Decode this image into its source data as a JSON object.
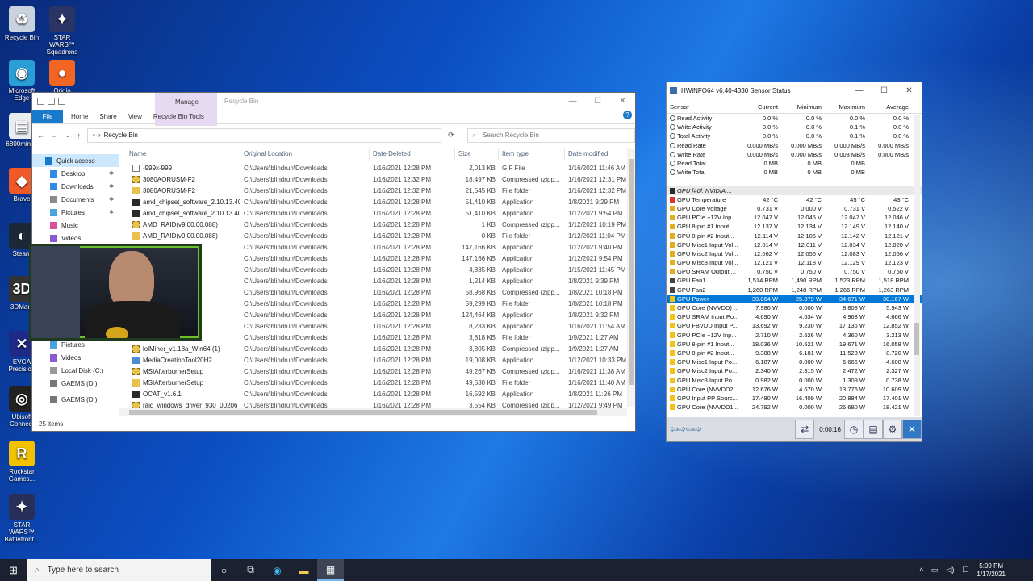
{
  "desktop": {
    "icons": [
      {
        "label": "Recycle Bin"
      },
      {
        "label": "STAR WARS™ Squadrons"
      },
      {
        "label": "Microsoft Edge"
      },
      {
        "label": "Origin"
      },
      {
        "label": "6800mini..."
      },
      {
        "label": "Brave"
      },
      {
        "label": "Steam"
      },
      {
        "label": "3DMark"
      },
      {
        "label": "EVGA Precision"
      },
      {
        "label": "Ubisoft Connect"
      },
      {
        "label": "Rockstar Games..."
      },
      {
        "label": "STAR WARS™ Battlefront..."
      }
    ]
  },
  "explorer": {
    "title": "Recycle Bin",
    "manage_label": "Manage",
    "tabs": [
      "File",
      "Home",
      "Share",
      "View",
      "Recycle Bin Tools"
    ],
    "address": "Recycle Bin",
    "search_placeholder": "Search Recycle Bin",
    "nav": [
      {
        "label": "Quick access"
      },
      {
        "label": "Desktop"
      },
      {
        "label": "Downloads"
      },
      {
        "label": "Documents"
      },
      {
        "label": "Pictures"
      },
      {
        "label": "Music"
      },
      {
        "label": "Videos"
      },
      {
        "label": "Pictures"
      },
      {
        "label": "Videos"
      },
      {
        "label": "Local Disk (C:)"
      },
      {
        "label": "GAEMS (D:)"
      },
      {
        "label": "GAEMS (D:)"
      }
    ],
    "columns": [
      "Name",
      "Original Location",
      "Date Deleted",
      "Size",
      "Item type",
      "Date modified"
    ],
    "rows": [
      {
        "icon": "gif",
        "name": "-999x-999",
        "loc": "C:\\Users\\blindrun\\Downloads",
        "del": "1/16/2021 12:28 PM",
        "size": "2,013 KB",
        "type": "GIF File",
        "mod": "1/16/2021 11:46 AM"
      },
      {
        "icon": "zip",
        "name": "3080AORUSM-F2",
        "loc": "C:\\Users\\blindrun\\Downloads",
        "del": "1/16/2021 12:32 PM",
        "size": "18,497 KB",
        "type": "Compressed (zipp...",
        "mod": "1/16/2021 12:31 PM"
      },
      {
        "icon": "folder",
        "name": "3080AORUSM-F2",
        "loc": "C:\\Users\\blindrun\\Downloads",
        "del": "1/16/2021 12:32 PM",
        "size": "21,545 KB",
        "type": "File folder",
        "mod": "1/16/2021 12:32 PM"
      },
      {
        "icon": "app",
        "name": "amd_chipset_software_2.10.13.408",
        "loc": "C:\\Users\\blindrun\\Downloads",
        "del": "1/16/2021 12:28 PM",
        "size": "51,410 KB",
        "type": "Application",
        "mod": "1/8/2021 9:29 PM"
      },
      {
        "icon": "app",
        "name": "amd_chipset_software_2.10.13.408 ...",
        "loc": "C:\\Users\\blindrun\\Downloads",
        "del": "1/16/2021 12:28 PM",
        "size": "51,410 KB",
        "type": "Application",
        "mod": "1/12/2021 9:54 PM"
      },
      {
        "icon": "zip",
        "name": "AMD_RAID(v9.00.00.088)",
        "loc": "C:\\Users\\blindrun\\Downloads",
        "del": "1/16/2021 12:28 PM",
        "size": "1 KB",
        "type": "Compressed (zipp...",
        "mod": "1/12/2021 10:19 PM"
      },
      {
        "icon": "folder",
        "name": "AMD_RAID(v9.00.00.088)",
        "loc": "C:\\Users\\blindrun\\Downloads",
        "del": "1/16/2021 12:28 PM",
        "size": "0 KB",
        "type": "File folder",
        "mod": "1/12/2021 11:04 PM"
      },
      {
        "icon": "app",
        "name": ".28.009",
        "loc": "C:\\Users\\blindrun\\Downloads",
        "del": "1/16/2021 12:28 PM",
        "size": "147,166 KB",
        "type": "Application",
        "mod": "1/12/2021 9:40 PM"
      },
      {
        "icon": "app",
        "name": ".28.009 (1)",
        "loc": "C:\\Users\\blindrun\\Downloads",
        "del": "1/16/2021 12:28 PM",
        "size": "147,166 KB",
        "type": "Application",
        "mod": "1/12/2021 9:54 PM"
      },
      {
        "icon": "app",
        "name": "",
        "loc": "C:\\Users\\blindrun\\Downloads",
        "del": "1/16/2021 12:28 PM",
        "size": "4,835 KB",
        "type": "Application",
        "mod": "1/15/2021 11:45 PM"
      },
      {
        "icon": "app",
        "name": "001",
        "loc": "C:\\Users\\blindrun\\Downloads",
        "del": "1/16/2021 12:28 PM",
        "size": "1,214 KB",
        "type": "Application",
        "mod": "1/8/2021 9:39 PM"
      },
      {
        "icon": "zip",
        "name": "4",
        "loc": "C:\\Users\\blindrun\\Downloads",
        "del": "1/16/2021 12:28 PM",
        "size": "58,968 KB",
        "type": "Compressed (zipp...",
        "mod": "1/8/2021 10:18 PM"
      },
      {
        "icon": "folder",
        "name": "4",
        "loc": "C:\\Users\\blindrun\\Downloads",
        "del": "1/16/2021 12:28 PM",
        "size": "59,299 KB",
        "type": "File folder",
        "mod": "1/8/2021 10:18 PM"
      },
      {
        "icon": "app",
        "name": "20.5.70",
        "loc": "C:\\Users\\blindrun\\Downloads",
        "del": "1/16/2021 12:28 PM",
        "size": "124,464 KB",
        "type": "Application",
        "mod": "1/8/2021 9:32 PM"
      },
      {
        "icon": "app",
        "name": "",
        "loc": "C:\\Users\\blindrun\\Downloads",
        "del": "1/16/2021 12:28 PM",
        "size": "8,233 KB",
        "type": "Application",
        "mod": "1/16/2021 11:54 AM"
      },
      {
        "icon": "folder",
        "name": "(1)",
        "loc": "C:\\Users\\blindrun\\Downloads",
        "del": "1/16/2021 12:28 PM",
        "size": "3,818 KB",
        "type": "File folder",
        "mod": "1/9/2021 1:27 AM"
      },
      {
        "icon": "zip",
        "name": "lolMiner_v1.18a_Win64 (1)",
        "loc": "C:\\Users\\blindrun\\Downloads",
        "del": "1/16/2021 12:28 PM",
        "size": "3,805 KB",
        "type": "Compressed (zipp...",
        "mod": "1/9/2021 1:27 AM"
      },
      {
        "icon": "exe",
        "name": "MediaCreationTool20H2",
        "loc": "C:\\Users\\blindrun\\Downloads",
        "del": "1/16/2021 12:28 PM",
        "size": "19,008 KB",
        "type": "Application",
        "mod": "1/12/2021 10:33 PM"
      },
      {
        "icon": "zip",
        "name": "MSIAfterburnerSetup",
        "loc": "C:\\Users\\blindrun\\Downloads",
        "del": "1/16/2021 12:28 PM",
        "size": "49,267 KB",
        "type": "Compressed (zipp...",
        "mod": "1/16/2021 11:38 AM"
      },
      {
        "icon": "folder",
        "name": "MSIAfterburnerSetup",
        "loc": "C:\\Users\\blindrun\\Downloads",
        "del": "1/16/2021 12:28 PM",
        "size": "49,530 KB",
        "type": "File folder",
        "mod": "1/16/2021 11:40 AM"
      },
      {
        "icon": "app",
        "name": "OCAT_v1.6.1",
        "loc": "C:\\Users\\blindrun\\Downloads",
        "del": "1/16/2021 12:28 PM",
        "size": "16,592 KB",
        "type": "Application",
        "mod": "1/8/2021 11:26 PM"
      },
      {
        "icon": "zip",
        "name": "raid_windows_driver_930_00206",
        "loc": "C:\\Users\\blindrun\\Downloads",
        "del": "1/16/2021 12:28 PM",
        "size": "3,554 KB",
        "type": "Compressed (zipp...",
        "mod": "1/12/2021 9:49 PM"
      }
    ],
    "status": "25 items"
  },
  "hwinfo": {
    "title": "HWiNFO64 v6.40-4330 Sensor Status",
    "columns": [
      "Sensor",
      "Current",
      "Minimum",
      "Maximum",
      "Average"
    ],
    "rows": [
      {
        "icon": "clock",
        "s": "Read Activity",
        "c": "0.0 %",
        "mn": "0.0 %",
        "mx": "0.0 %",
        "a": "0.0 %"
      },
      {
        "icon": "clock",
        "s": "Write Activity",
        "c": "0.0 %",
        "mn": "0.0 %",
        "mx": "0.1 %",
        "a": "0.0 %"
      },
      {
        "icon": "clock",
        "s": "Total Activity",
        "c": "0.0 %",
        "mn": "0.0 %",
        "mx": "0.1 %",
        "a": "0.0 %"
      },
      {
        "icon": "clock",
        "s": "Read Rate",
        "c": "0.000 MB/s",
        "mn": "0.000 MB/s",
        "mx": "0.000 MB/s",
        "a": "0.000 MB/s"
      },
      {
        "icon": "clock",
        "s": "Write Rate",
        "c": "0.000 MB/s",
        "mn": "0.000 MB/s",
        "mx": "0.003 MB/s",
        "a": "0.000 MB/s"
      },
      {
        "icon": "clock",
        "s": "Read Total",
        "c": "0 MB",
        "mn": "0 MB",
        "mx": "0 MB",
        "a": ""
      },
      {
        "icon": "clock",
        "s": "Write Total",
        "c": "0 MB",
        "mn": "0 MB",
        "mx": "0 MB",
        "a": ""
      },
      {
        "kind": "blank",
        "s": "",
        "c": "",
        "mn": "",
        "mx": "",
        "a": ""
      },
      {
        "kind": "group",
        "icon": "gpu",
        "s": "GPU [#0]: NVIDIA ...",
        "c": "",
        "mn": "",
        "mx": "",
        "a": ""
      },
      {
        "icon": "temp",
        "s": "GPU Temperature",
        "c": "42 °C",
        "mn": "42 °C",
        "mx": "45 °C",
        "a": "43 °C"
      },
      {
        "icon": "volt",
        "s": "GPU Core Voltage",
        "c": "0.731 V",
        "mn": "0.000 V",
        "mx": "0.731 V",
        "a": "0.522 V"
      },
      {
        "icon": "volt",
        "s": "GPU PCIe +12V Inp...",
        "c": "12.047 V",
        "mn": "12.045 V",
        "mx": "12.047 V",
        "a": "12.046 V"
      },
      {
        "icon": "volt",
        "s": "GPU 8-pin #1 Input...",
        "c": "12.137 V",
        "mn": "12.134 V",
        "mx": "12.149 V",
        "a": "12.140 V"
      },
      {
        "icon": "volt",
        "s": "GPU 8-pin #2 Input...",
        "c": "12.114 V",
        "mn": "12.106 V",
        "mx": "12.142 V",
        "a": "12.121 V"
      },
      {
        "icon": "volt",
        "s": "GPU Misc1 Input Vol...",
        "c": "12.014 V",
        "mn": "12.011 V",
        "mx": "12.034 V",
        "a": "12.020 V"
      },
      {
        "icon": "volt",
        "s": "GPU Misc2 Input Vol...",
        "c": "12.062 V",
        "mn": "12.056 V",
        "mx": "12.083 V",
        "a": "12.066 V"
      },
      {
        "icon": "volt",
        "s": "GPU Misc3 Input Vol...",
        "c": "12.121 V",
        "mn": "12.118 V",
        "mx": "12.129 V",
        "a": "12.123 V"
      },
      {
        "icon": "volt",
        "s": "GPU SRAM Output ...",
        "c": "0.750 V",
        "mn": "0.750 V",
        "mx": "0.750 V",
        "a": "0.750 V"
      },
      {
        "icon": "fan",
        "s": "GPU Fan1",
        "c": "1,514 RPM",
        "mn": "1,490 RPM",
        "mx": "1,523 RPM",
        "a": "1,518 RPM"
      },
      {
        "icon": "fan",
        "s": "GPU Fan2",
        "c": "1,260 RPM",
        "mn": "1,248 RPM",
        "mx": "1,266 RPM",
        "a": "1,263 RPM"
      },
      {
        "kind": "sel",
        "icon": "pow",
        "s": "GPU Power",
        "c": "30.064 W",
        "mn": "25.879 W",
        "mx": "34.671 W",
        "a": "30.167 W"
      },
      {
        "icon": "pow",
        "s": "GPU Core (NVVDD) ...",
        "c": "7.986 W",
        "mn": "0.000 W",
        "mx": "8.808 W",
        "a": "5.943 W"
      },
      {
        "icon": "pow",
        "s": "GPU SRAM Input Po...",
        "c": "4.690 W",
        "mn": "4.634 W",
        "mx": "4.968 W",
        "a": "4.666 W"
      },
      {
        "icon": "pow",
        "s": "GPU FBVDD Input P...",
        "c": "13.692 W",
        "mn": "9.230 W",
        "mx": "17.136 W",
        "a": "12.852 W"
      },
      {
        "icon": "pow",
        "s": "GPU PCIe +12V Inp...",
        "c": "2.710 W",
        "mn": "2.626 W",
        "mx": "4.360 W",
        "a": "3.213 W"
      },
      {
        "icon": "pow",
        "s": "GPU 8-pin #1 Input...",
        "c": "18.036 W",
        "mn": "10.521 W",
        "mx": "19.671 W",
        "a": "16.058 W"
      },
      {
        "icon": "pow",
        "s": "GPU 8-pin #2 Input...",
        "c": "9.388 W",
        "mn": "6.181 W",
        "mx": "11.528 W",
        "a": "8.720 W"
      },
      {
        "icon": "pow",
        "s": "GPU Misc1 Input Po...",
        "c": "6.187 W",
        "mn": "0.000 W",
        "mx": "6.666 W",
        "a": "4.600 W"
      },
      {
        "icon": "pow",
        "s": "GPU Misc2 Input Po...",
        "c": "2.340 W",
        "mn": "2.315 W",
        "mx": "2.472 W",
        "a": "2.327 W"
      },
      {
        "icon": "pow",
        "s": "GPU Misc3 Input Po...",
        "c": "0.982 W",
        "mn": "0.000 W",
        "mx": "1.309 W",
        "a": "0.738 W"
      },
      {
        "icon": "pow",
        "s": "GPU Core (NVVDD2...",
        "c": "12.676 W",
        "mn": "4.670 W",
        "mx": "13.776 W",
        "a": "10.609 W"
      },
      {
        "icon": "pow",
        "s": "GPU Input PP Sourc...",
        "c": "17.480 W",
        "mn": "16.409 W",
        "mx": "20.884 W",
        "a": "17.401 W"
      },
      {
        "icon": "pow",
        "s": "GPU Core (NVVDD1...",
        "c": "24.792 W",
        "mn": "0.000 W",
        "mx": "26.680 W",
        "a": "18.421 W"
      }
    ],
    "timer": "0:00:16"
  },
  "taskbar": {
    "search_placeholder": "Type here to search",
    "time": "5:09 PM",
    "date": "1/17/2021"
  }
}
